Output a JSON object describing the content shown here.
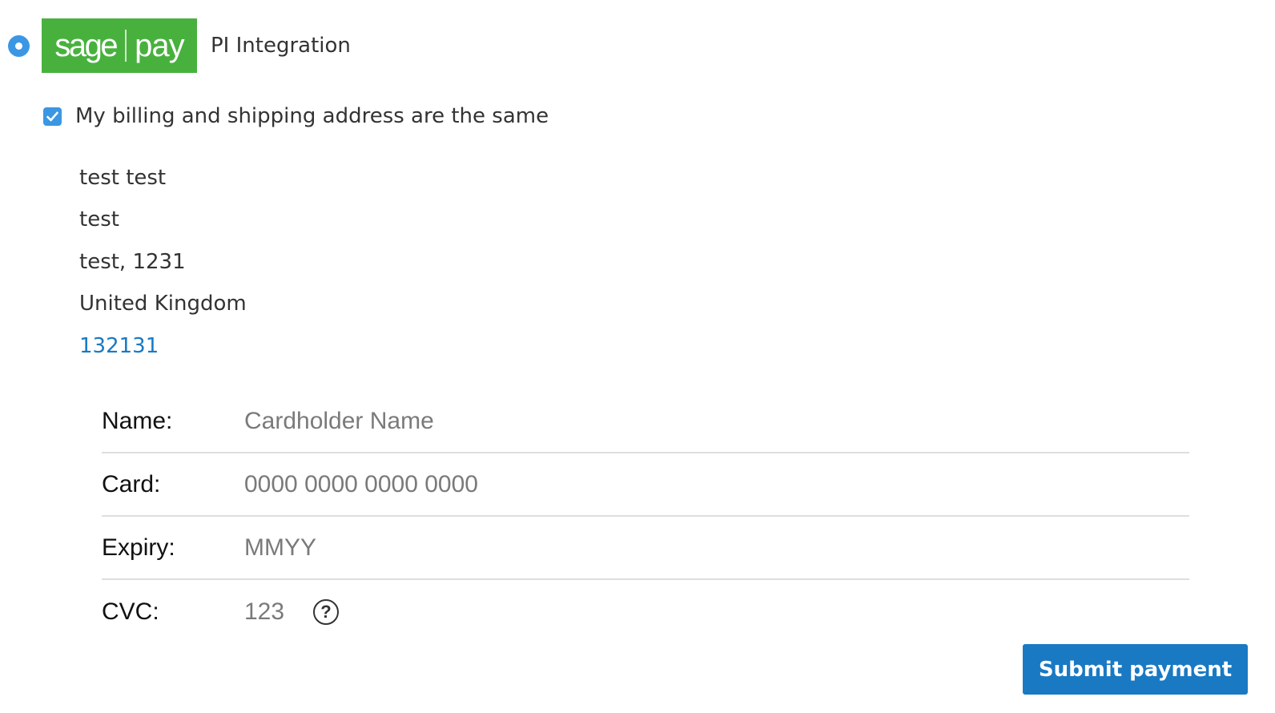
{
  "payment_method": {
    "selected": true,
    "logo": {
      "word1": "sage",
      "word2": "pay"
    },
    "title": "PI Integration"
  },
  "billing": {
    "same_as_shipping": true,
    "same_label": "My billing and shipping address are the same",
    "address": {
      "name": "test test",
      "street": "test",
      "city_postcode": "test, 1231",
      "country": "United Kingdom",
      "phone": "132131"
    }
  },
  "card_form": {
    "name": {
      "label": "Name:",
      "placeholder": "Cardholder Name"
    },
    "card": {
      "label": "Card:",
      "placeholder": "0000 0000 0000 0000"
    },
    "expiry": {
      "label": "Expiry:",
      "placeholder": "MMYY"
    },
    "cvc": {
      "label": "CVC:",
      "placeholder": "123",
      "help_icon": "question-circle-icon",
      "help_glyph": "?"
    }
  },
  "submit": {
    "label": "Submit payment"
  },
  "colors": {
    "accent": "#3b97e3",
    "brand_green": "#48b13e",
    "button": "#1979c3",
    "link": "#1979c3"
  }
}
